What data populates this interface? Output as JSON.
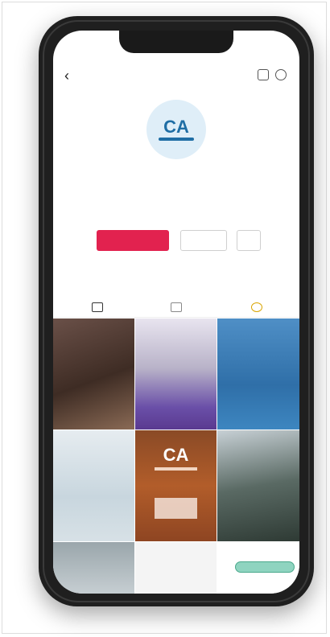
{
  "status": {
    "time": "",
    "icons": ""
  },
  "profile": {
    "username": "",
    "handle": "",
    "subtitle": "",
    "avatar_text": "CA",
    "stats": [
      {
        "number": "",
        "label": ""
      },
      {
        "number": "",
        "label": ""
      },
      {
        "number": "",
        "label": ""
      }
    ],
    "follow_label": "",
    "message_label": "",
    "more_label": "",
    "bio": [
      "",
      "",
      ""
    ]
  },
  "posts": {
    "tile_logo_text": "CA",
    "pill_label": ""
  },
  "colors": {
    "accent": "#e2224f",
    "link": "#2a5aa0",
    "frame": "#1f1f1f"
  },
  "icons": [
    "back-arrow-icon",
    "bell-icon",
    "menu-icon",
    "grid-tab-icon",
    "video-tab-icon",
    "saved-tab-icon"
  ]
}
